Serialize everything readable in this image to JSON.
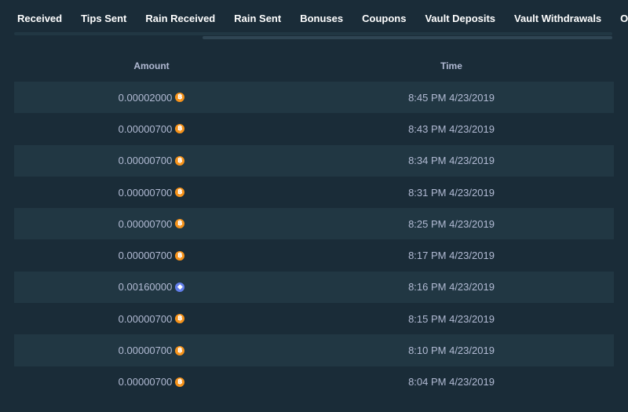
{
  "tabs": [
    {
      "label": "Received",
      "active": false
    },
    {
      "label": "Tips Sent",
      "active": false
    },
    {
      "label": "Rain Received",
      "active": false
    },
    {
      "label": "Rain Sent",
      "active": false
    },
    {
      "label": "Bonuses",
      "active": false
    },
    {
      "label": "Coupons",
      "active": false
    },
    {
      "label": "Vault Deposits",
      "active": true
    },
    {
      "label": "Vault Withdrawals",
      "active": false
    },
    {
      "label": "Other",
      "active": false
    }
  ],
  "table": {
    "headers": {
      "amount": "Amount",
      "time": "Time"
    },
    "rows": [
      {
        "amount": "0.00002000",
        "currency": "btc",
        "time": "8:45 PM 4/23/2019"
      },
      {
        "amount": "0.00000700",
        "currency": "btc",
        "time": "8:43 PM 4/23/2019"
      },
      {
        "amount": "0.00000700",
        "currency": "btc",
        "time": "8:34 PM 4/23/2019"
      },
      {
        "amount": "0.00000700",
        "currency": "btc",
        "time": "8:31 PM 4/23/2019"
      },
      {
        "amount": "0.00000700",
        "currency": "btc",
        "time": "8:25 PM 4/23/2019"
      },
      {
        "amount": "0.00000700",
        "currency": "btc",
        "time": "8:17 PM 4/23/2019"
      },
      {
        "amount": "0.00160000",
        "currency": "eth",
        "time": "8:16 PM 4/23/2019"
      },
      {
        "amount": "0.00000700",
        "currency": "btc",
        "time": "8:15 PM 4/23/2019"
      },
      {
        "amount": "0.00000700",
        "currency": "btc",
        "time": "8:10 PM 4/23/2019"
      },
      {
        "amount": "0.00000700",
        "currency": "btc",
        "time": "8:04 PM 4/23/2019"
      }
    ]
  },
  "icons": {
    "btc": {
      "name": "bitcoin-icon",
      "glyph": "฿",
      "color": "#f7931a"
    },
    "eth": {
      "name": "ethereum-icon",
      "glyph": "◆",
      "color": "#627eea"
    }
  },
  "colors": {
    "background": "#1a2c38",
    "row_alt": "#213743",
    "text": "#b1bad3",
    "accent": "#1475e1"
  }
}
